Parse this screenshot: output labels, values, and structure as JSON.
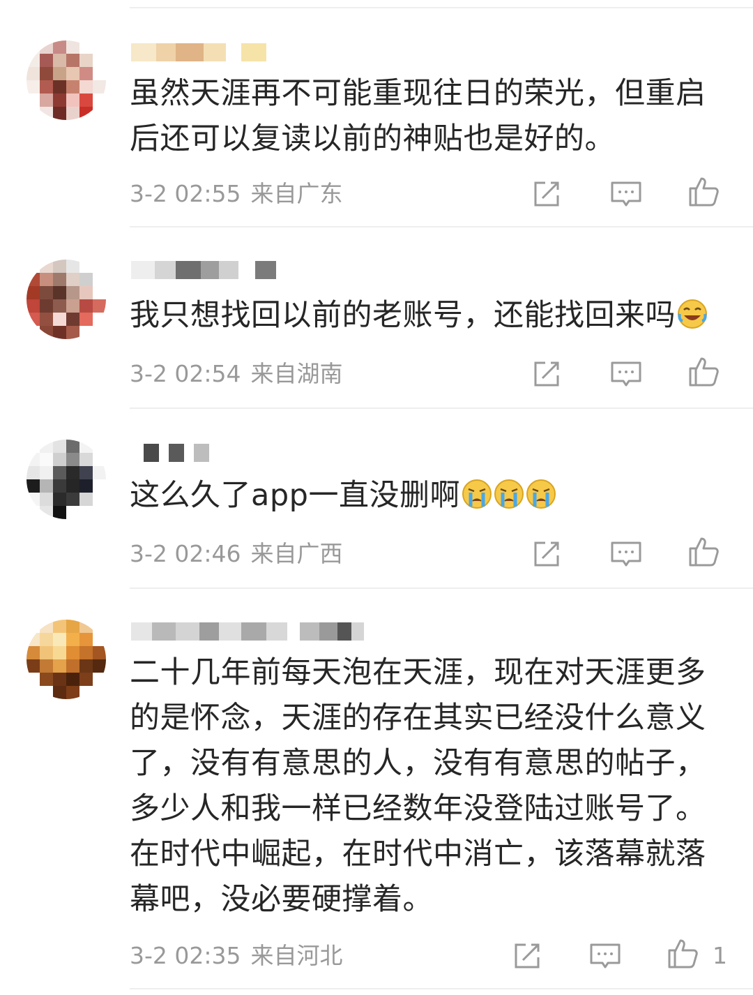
{
  "comments": [
    {
      "text": "虽然天涯再不可能重现往日的荣光，但重启\n后还可以复读以前的神贴也是好的。",
      "time": "3-2 02:55",
      "location": "来自广东",
      "likes": ""
    },
    {
      "text": "我只想找回以前的老账号，还能找回来吗",
      "time": "3-2 02:54",
      "location": "来自湖南",
      "likes": "",
      "emoji": [
        "laugh-cry-icon"
      ]
    },
    {
      "text": "这么久了app一直没删啊",
      "time": "3-2 02:46",
      "location": "来自广西",
      "likes": "",
      "emoji": [
        "crying-icon",
        "crying-icon",
        "crying-icon"
      ]
    },
    {
      "text": "二十几年前每天泡在天涯，现在对天涯更多\n的是怀念，天涯的存在其实已经没什么意义\n了，没有有意思的人，没有有意思的帖子，\n多少人和我一样已经数年没登陆过账号了。\n在时代中崛起，在时代中消亡，该落幕就落\n幕吧，没必要硬撑着。",
      "time": "3-2 02:35",
      "location": "来自河北",
      "likes": "1"
    }
  ],
  "icons": {
    "repost": "repost-icon",
    "comment": "comment-icon",
    "like": "thumbs-up-icon"
  },
  "colors": {
    "text": "#262626",
    "meta": "#999999",
    "icon": "#9a9a9a",
    "divider": "#eeeeee"
  }
}
